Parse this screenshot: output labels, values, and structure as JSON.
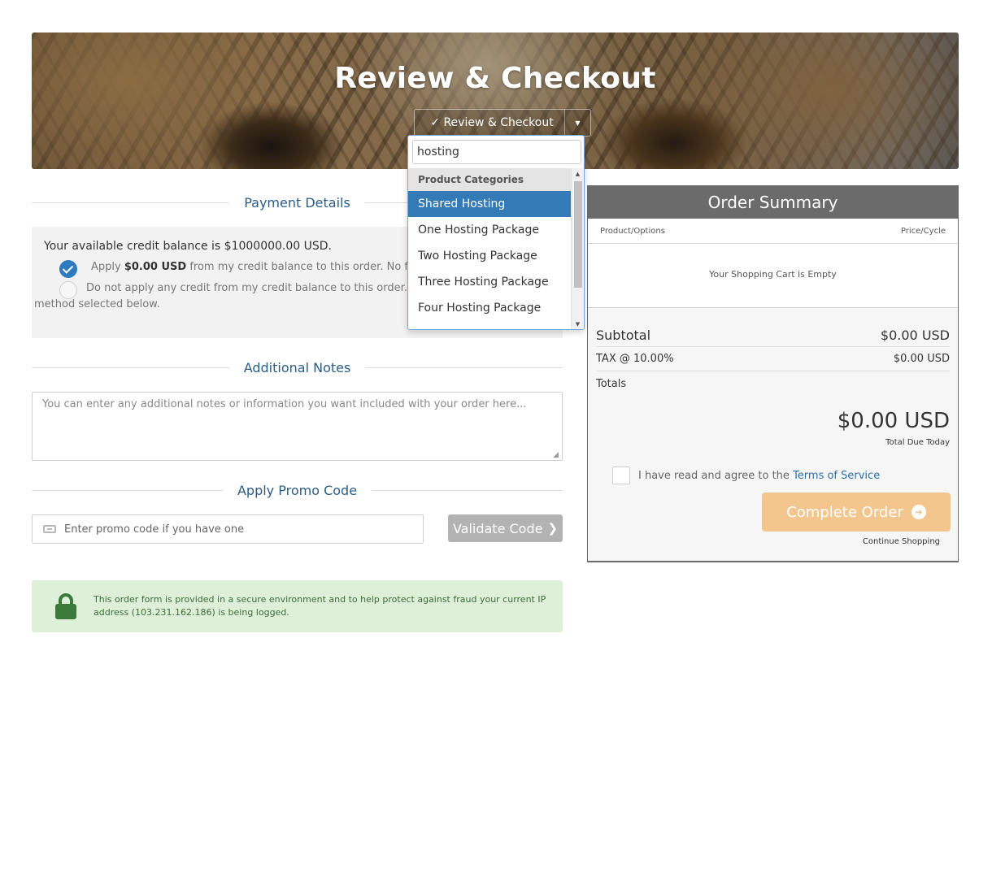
{
  "hero": {
    "title": "Review & Checkout",
    "category_button": "✓ Review & Checkout"
  },
  "dropdown": {
    "search_value": "hosting",
    "group_label": "Product Categories",
    "items": [
      {
        "label": "Shared Hosting",
        "active": true
      },
      {
        "label": "One Hosting Package",
        "active": false
      },
      {
        "label": "Two Hosting Package",
        "active": false
      },
      {
        "label": "Three Hosting Package",
        "active": false
      },
      {
        "label": "Four Hosting Package",
        "active": false
      }
    ]
  },
  "payment": {
    "heading": "Payment Details",
    "credit_balance": "Your available credit balance is $1000000.00 USD.",
    "apply_prefix": "Apply ",
    "apply_amount": "$0.00 USD",
    "apply_suffix": " from my credit balance to this order. No further pa",
    "no_apply_line1": "Do not apply any credit from my credit balance to this order. I will pa",
    "no_apply_line2": "method selected below."
  },
  "notes": {
    "heading": "Additional Notes",
    "placeholder": "You can enter any additional notes or information you want included with your order here..."
  },
  "promo": {
    "heading": "Apply Promo Code",
    "placeholder": "Enter promo code if you have one",
    "validate_label": "Validate Code"
  },
  "secure": {
    "text": "This order form is provided in a secure environment and to help protect against fraud your current IP address (103.231.162.186) is being logged."
  },
  "summary": {
    "title": "Order Summary",
    "col_product": "Product/Options",
    "col_price": "Price/Cycle",
    "empty_text": "Your Shopping Cart is Empty",
    "subtotal_label": "Subtotal",
    "subtotal_value": "$0.00 USD",
    "tax_label": "TAX @ 10.00%",
    "tax_value": "$0.00 USD",
    "totals_label": "Totals",
    "total_amount": "$0.00 USD",
    "total_caption": "Total Due Today",
    "tos_prefix": "I have read and agree to the ",
    "tos_link": "Terms of Service",
    "complete_label": "Complete Order",
    "continue_label": "Continue Shopping"
  },
  "colors": {
    "accent_blue": "#337ab7",
    "heading_blue": "#2b5d84",
    "complete_button": "#f2c68d",
    "summary_header": "#6b6b6b",
    "secure_bg": "#dff0d8"
  }
}
